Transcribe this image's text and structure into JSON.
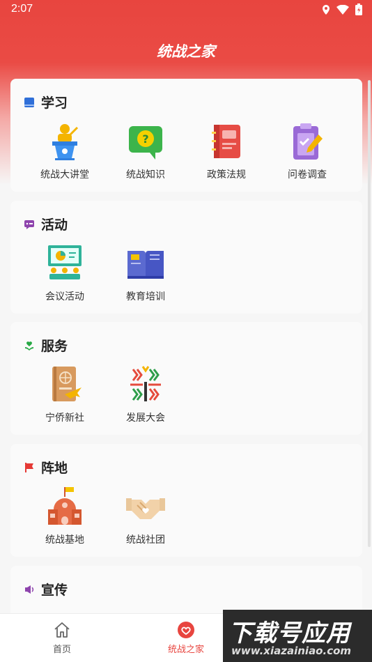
{
  "status_bar": {
    "time": "2:07"
  },
  "app": {
    "title": "统战之家"
  },
  "sections": [
    {
      "title": "学习",
      "items": [
        {
          "label": "统战大讲堂",
          "icon": "lecture-podium-icon"
        },
        {
          "label": "统战知识",
          "icon": "question-chat-icon"
        },
        {
          "label": "政策法规",
          "icon": "red-notebook-icon"
        },
        {
          "label": "问卷调查",
          "icon": "clipboard-survey-icon"
        }
      ]
    },
    {
      "title": "活动",
      "items": [
        {
          "label": "会议活动",
          "icon": "meeting-presentation-icon"
        },
        {
          "label": "教育培训",
          "icon": "open-book-icon"
        }
      ]
    },
    {
      "title": "服务",
      "items": [
        {
          "label": "宁侨新社",
          "icon": "passport-plane-icon"
        },
        {
          "label": "发展大会",
          "icon": "development-conference-logo-icon"
        }
      ]
    },
    {
      "title": "阵地",
      "items": [
        {
          "label": "统战基地",
          "icon": "base-building-flag-icon"
        },
        {
          "label": "统战社团",
          "icon": "handshake-heart-icon"
        }
      ]
    },
    {
      "title": "宣传",
      "items": []
    }
  ],
  "bottom_nav": {
    "home_label": "首页",
    "family_label": "统战之家"
  },
  "watermark": {
    "big": "下载号应用",
    "small": "www.xiazainiao.com"
  },
  "colors": {
    "accent": "#e8453f",
    "active": "#e8453f",
    "text": "#333333"
  }
}
